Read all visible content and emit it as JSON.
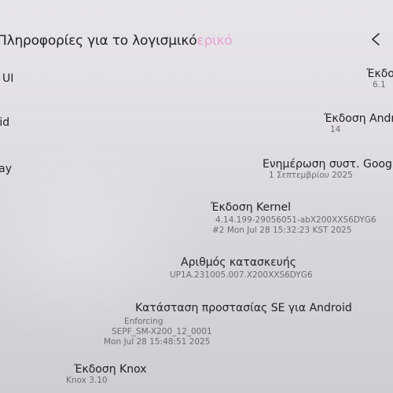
{
  "header": {
    "title": "Πληροφορίες για το λογισμικό",
    "title_ghost": "ερικό"
  },
  "left_labels": {
    "one_ui": "Έκδοση One UI",
    "android": "Έκδοση Android",
    "google_play": "Ενημέρωση συστ. Google Play"
  },
  "items": [
    {
      "label": "Έκδοση One UI",
      "value": "6.1"
    },
    {
      "label": "Έκδοση Android",
      "value": "14"
    },
    {
      "label": "Ενημέρωση συστ. Google Play",
      "value": "1 Σεπτεμβρίου 2025"
    },
    {
      "label": "Έκδοση Kernel",
      "value": "4.14.199-29056051-abX200XXS6DYG6",
      "value2": "#2 Mon Jul 28 15:32:23 KST 2025"
    },
    {
      "label": "Αριθμός κατασκευής",
      "value": "UP1A.231005.007.X200XXS6DYG6"
    },
    {
      "label": "Κατάσταση προστασίας SE για Android",
      "value": "Enforcing",
      "value2": "SEPF_SM-X200_12_0001",
      "value3": "Mon Jul 28 15:48:51 2025"
    },
    {
      "label": "Έκδοση Knox",
      "value": "Knox 3.10"
    }
  ],
  "colors": {
    "background": "#e4e1e7",
    "text_primary": "#232328",
    "text_secondary": "#6c6c74",
    "ghost_accent": "#e58bc8"
  }
}
